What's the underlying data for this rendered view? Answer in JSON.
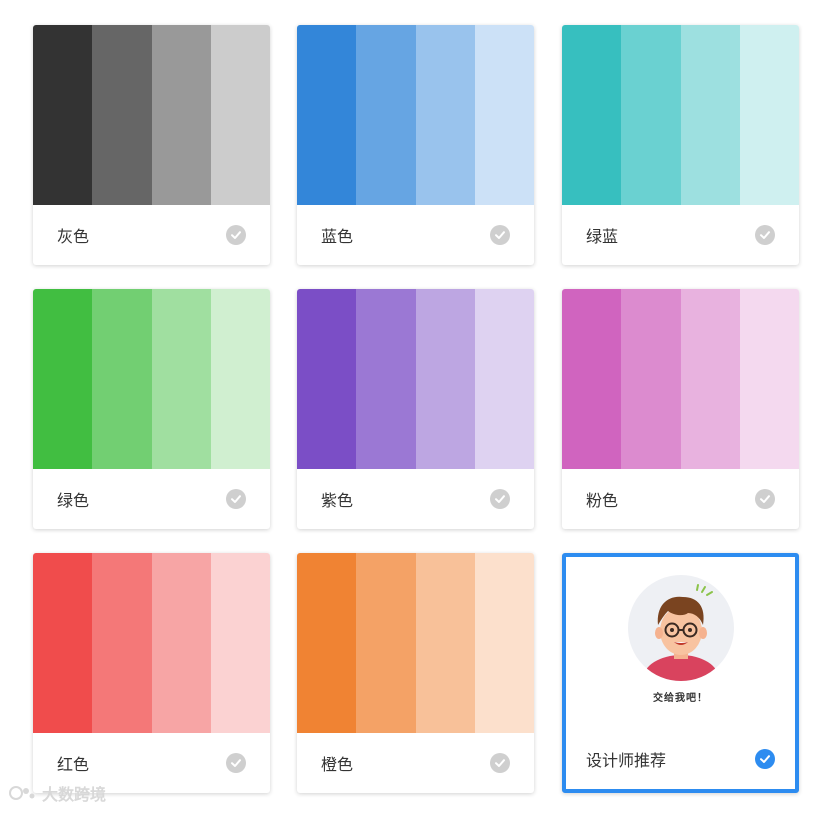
{
  "palettes": [
    {
      "label": "灰色",
      "colors": [
        "#333333",
        "#666666",
        "#999999",
        "#cccccc"
      ]
    },
    {
      "label": "蓝色",
      "colors": [
        "#3386d9",
        "#66a5e3",
        "#99c3ed",
        "#cce1f7"
      ]
    },
    {
      "label": "绿蓝",
      "colors": [
        "#37bfbf",
        "#6ad1d1",
        "#9de0e0",
        "#cff0f0"
      ]
    },
    {
      "label": "绿色",
      "colors": [
        "#41be41",
        "#72cf72",
        "#a0dfa0",
        "#d0efd0"
      ]
    },
    {
      "label": "紫色",
      "colors": [
        "#7b4ec6",
        "#9b78d4",
        "#bda6e2",
        "#ded2f1"
      ]
    },
    {
      "label": "粉色",
      "colors": [
        "#d064bf",
        "#dc8bcf",
        "#e8b2df",
        "#f4d9ef"
      ]
    },
    {
      "label": "红色",
      "colors": [
        "#f04c4c",
        "#f47878",
        "#f7a5a5",
        "#fbd2d2"
      ]
    },
    {
      "label": "橙色",
      "colors": [
        "#f08333",
        "#f4a266",
        "#f8c199",
        "#fce0cc"
      ]
    }
  ],
  "designer": {
    "label": "设计师推荐",
    "caption": "交给我吧！"
  },
  "watermark": {
    "text": "大数跨境"
  },
  "colors": {
    "accent": "#2d8cf0",
    "check_inactive": "#cfcfcf"
  }
}
